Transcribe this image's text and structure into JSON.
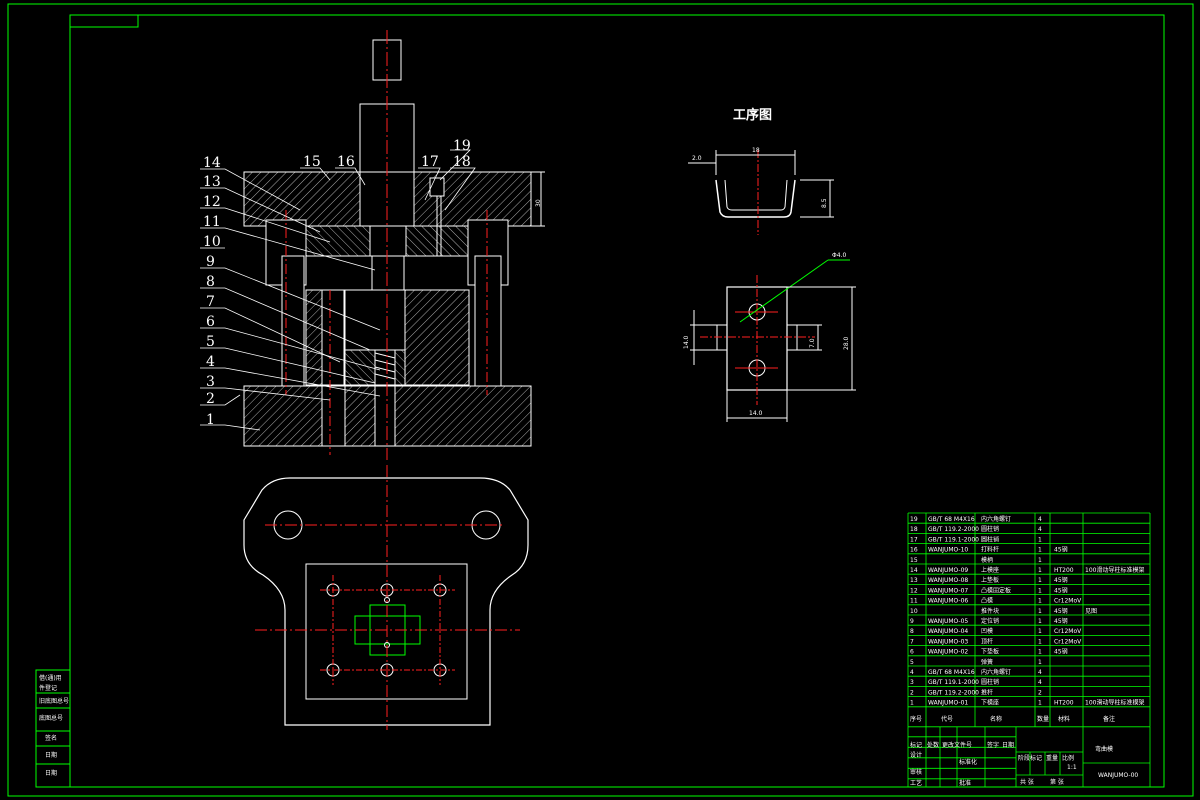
{
  "colors": {
    "background": "#000000",
    "frame": "#00ff00",
    "outline": "#ffffff",
    "centerline": "#ff2020",
    "hatch": "#ffffff",
    "section_fill": "#1a1a1a"
  },
  "process_title": "工序图",
  "part_labels": [
    "1",
    "2",
    "3",
    "4",
    "5",
    "6",
    "7",
    "8",
    "9",
    "10",
    "11",
    "12",
    "13",
    "14",
    "15",
    "16",
    "17",
    "18",
    "19"
  ],
  "dimensions": {
    "top_width": "18",
    "left_offset": "2.0",
    "height_profile": "8.5",
    "hole_dia": "Φ4.0",
    "plan_height": "14.0",
    "plan_tab": "7.0",
    "plan_total": "28.0",
    "plan_width": "14.0",
    "die_height": "30"
  },
  "bom": {
    "header": [
      "序号",
      "代号",
      "名称",
      "数量",
      "材料",
      "备注"
    ],
    "rows": [
      {
        "no": "19",
        "code": "GB/T 68 M4X16",
        "name": "内六角螺钉",
        "qty": "4",
        "mat": "",
        "note": ""
      },
      {
        "no": "18",
        "code": "GB/T 119.2-2000",
        "name": "圆柱销",
        "qty": "4",
        "mat": "",
        "note": ""
      },
      {
        "no": "17",
        "code": "GB/T 119.1-2000",
        "name": "圆柱销",
        "qty": "1",
        "mat": "",
        "note": ""
      },
      {
        "no": "16",
        "code": "WANJUMO-10",
        "name": "打料杆",
        "qty": "1",
        "mat": "45钢",
        "note": ""
      },
      {
        "no": "15",
        "code": "",
        "name": "模柄",
        "qty": "1",
        "mat": "",
        "note": ""
      },
      {
        "no": "14",
        "code": "WANJUMO-09",
        "name": "上模座",
        "qty": "1",
        "mat": "HT200",
        "note": "100滑动导柱标准模架"
      },
      {
        "no": "13",
        "code": "WANJUMO-08",
        "name": "上垫板",
        "qty": "1",
        "mat": "45钢",
        "note": ""
      },
      {
        "no": "12",
        "code": "WANJUMO-07",
        "name": "凸模固定板",
        "qty": "1",
        "mat": "45钢",
        "note": ""
      },
      {
        "no": "11",
        "code": "WANJUMO-06",
        "name": "凸模",
        "qty": "1",
        "mat": "Cr12MoV",
        "note": ""
      },
      {
        "no": "10",
        "code": "",
        "name": "推件块",
        "qty": "1",
        "mat": "45钢",
        "note": "见图"
      },
      {
        "no": "9",
        "code": "WANJUMO-05",
        "name": "定位销",
        "qty": "1",
        "mat": "45钢",
        "note": ""
      },
      {
        "no": "8",
        "code": "WANJUMO-04",
        "name": "凹模",
        "qty": "1",
        "mat": "Cr12MoV",
        "note": ""
      },
      {
        "no": "7",
        "code": "WANJUMO-03",
        "name": "顶杆",
        "qty": "1",
        "mat": "Cr12MoV",
        "note": ""
      },
      {
        "no": "6",
        "code": "WANJUMO-02",
        "name": "下垫板",
        "qty": "1",
        "mat": "45钢",
        "note": ""
      },
      {
        "no": "5",
        "code": "",
        "name": "弹簧",
        "qty": "1",
        "mat": "",
        "note": ""
      },
      {
        "no": "4",
        "code": "GB/T 68 M4X16",
        "name": "内六角螺钉",
        "qty": "4",
        "mat": "",
        "note": ""
      },
      {
        "no": "3",
        "code": "GB/T 119.1-2000",
        "name": "圆柱销",
        "qty": "4",
        "mat": "",
        "note": ""
      },
      {
        "no": "2",
        "code": "GB/T 119.2-2000",
        "name": "推杆",
        "qty": "2",
        "mat": "",
        "note": ""
      },
      {
        "no": "1",
        "code": "WANJUMO-01",
        "name": "下模座",
        "qty": "1",
        "mat": "HT200",
        "note": "100滑动导柱标准模架"
      }
    ],
    "drawing_name": "弯曲模",
    "drawing_code": "WANJUMO-00",
    "scale": "1:1",
    "sig_labels": [
      "标记",
      "处数",
      "更改文件号",
      "签字",
      "日期",
      "设计",
      "审核",
      "工艺",
      "标准化",
      "批准",
      "阶段标记",
      "重量",
      "比例",
      "共 张",
      "第 张"
    ]
  },
  "side_stamp": [
    "借(通)用",
    "件登记",
    "旧底图总号",
    "底图总号",
    "签名",
    "日期"
  ]
}
